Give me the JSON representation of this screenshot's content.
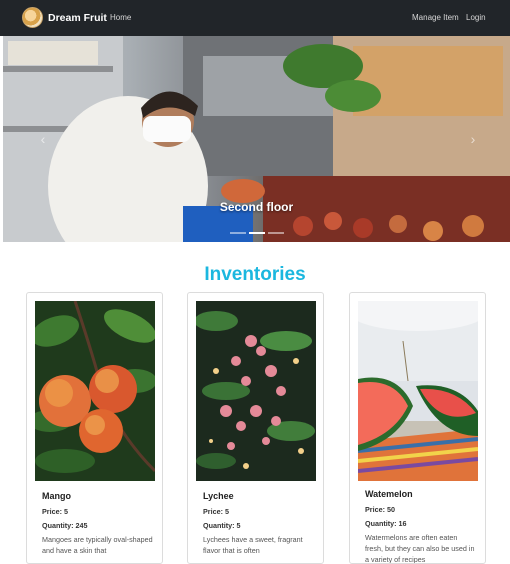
{
  "navbar": {
    "brand": "Dream Fruit",
    "home": "Home",
    "manage": "Manage Item",
    "login": "Login"
  },
  "carousel": {
    "caption": "Second floor",
    "prev": "‹",
    "next": "›",
    "slides": 3,
    "active": 1
  },
  "inventories": {
    "title": "Inventories",
    "items": [
      {
        "name": "Mango",
        "price": "Price: 5",
        "quantity": "Quantity: 245",
        "description": "Mangoes are typically oval-shaped and have a skin that"
      },
      {
        "name": "Lychee",
        "price": "Price: 5",
        "quantity": "Quantity: 5",
        "description": "Lychees have a sweet, fragrant flavor that is often"
      },
      {
        "name": "Watemelon",
        "price": "Price: 50",
        "quantity": "Quantity: 16",
        "description": "Watermelons are often eaten fresh, but they can also be used in a variety of recipes"
      }
    ]
  }
}
